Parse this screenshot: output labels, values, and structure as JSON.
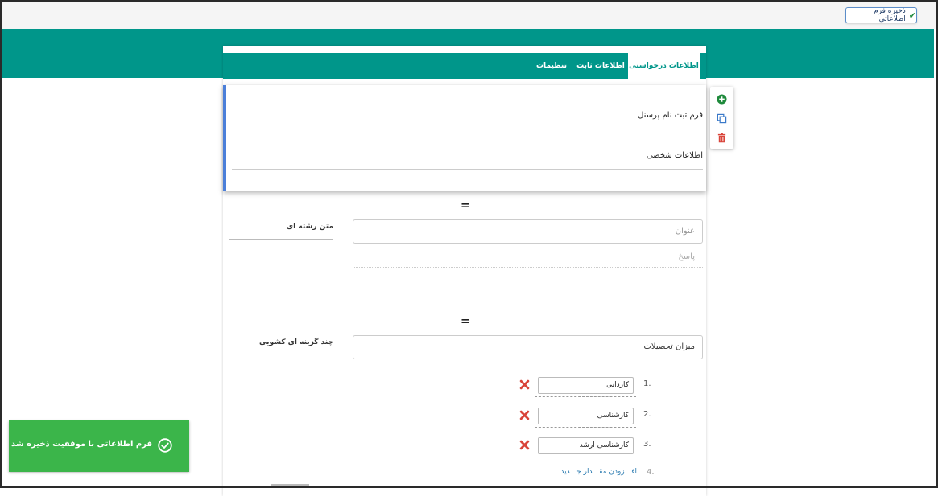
{
  "toolbar": {
    "save_label": "ذخیره فرم اطلاعاتی"
  },
  "tabs": [
    {
      "label": "اطلاعات درخواستی",
      "active": true
    },
    {
      "label": "اطلاعات ثابت",
      "active": false
    },
    {
      "label": "تنظیمات",
      "active": false
    }
  ],
  "form": {
    "title": "فرم ثبت نام پرسنل",
    "description": "اطلاعات شخصی"
  },
  "questions": [
    {
      "type_label": "متن رشته ای",
      "title_placeholder": "عنوان",
      "answer_placeholder": "پاسخ"
    },
    {
      "type_label": "چند گزینه ای کشویی",
      "title_value": "میزان تحصیلات",
      "options": [
        {
          "number": "1.",
          "value": "کاردانی"
        },
        {
          "number": "2.",
          "value": "کارشناسی"
        },
        {
          "number": "3.",
          "value": "کارشناسی ارشد"
        }
      ],
      "add_number": "4.",
      "add_label": "افـــزودن مقـــدار جـــدید"
    }
  ],
  "toast": {
    "message": "فرم اطلاعاتی با موفقیت ذخیره شد"
  },
  "drag_handle_glyph": "=",
  "colors": {
    "teal": "#00968a",
    "accent_border": "#4b7fd9",
    "toast_green": "#3bb54a",
    "add_green": "#1f8a3c",
    "delete_red": "#d9443a"
  }
}
